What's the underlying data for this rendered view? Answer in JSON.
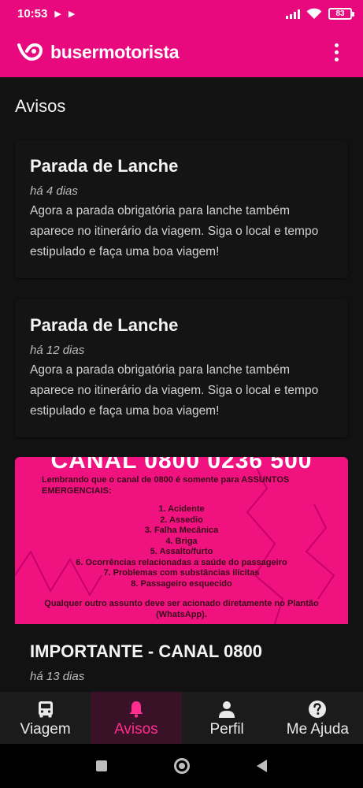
{
  "status_bar": {
    "time": "10:53",
    "battery": "83"
  },
  "app_bar": {
    "logo_text": "busermotorista"
  },
  "page": {
    "title": "Avisos"
  },
  "notices": [
    {
      "title": "Parada de Lanche",
      "date": "há 4 dias",
      "body": "Agora a parada obrigatória para lanche também aparece no itinerário da viagem. Siga o local e tempo estipulado e faça uma boa viagem!"
    },
    {
      "title": "Parada de Lanche",
      "date": "há 12 dias",
      "body": "Agora a parada obrigatória para lanche também aparece no itinerário da viagem. Siga o local e tempo estipulado e faça uma boa viagem!"
    },
    {
      "title": "IMPORTANTE - CANAL 0800",
      "date": "há 13 dias",
      "image": {
        "heading": "CANAL 0800 0236 500",
        "intro": "Lembrando que o canal de 0800 é somente para ASSUNTOS EMERGENCIAIS:",
        "items": [
          "1. Acidente",
          "2. Assedio",
          "3. Falha Mecânica",
          "4. Briga",
          "5. Assalto/furto",
          "6. Ocorrências relacionadas a saúde do passageiro",
          "7. Problemas com substâncias ilícitas",
          "8. Passageiro esquecido"
        ],
        "footer": "Qualquer outro assunto deve ser acionado diretamente no Plantão (WhatsApp)."
      }
    }
  ],
  "bottom_nav": [
    {
      "label": "Viagem",
      "icon": "bus-icon",
      "active": false
    },
    {
      "label": "Avisos",
      "icon": "bell-icon",
      "active": true
    },
    {
      "label": "Perfil",
      "icon": "person-icon",
      "active": false
    },
    {
      "label": "Me Ajuda",
      "icon": "help-icon",
      "active": false
    }
  ],
  "colors": {
    "brand": "#e8097e",
    "background": "#121212",
    "active_nav": "#ff2d8f"
  }
}
